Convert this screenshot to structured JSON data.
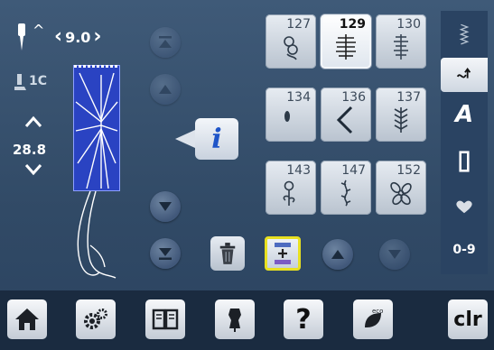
{
  "stitch_width": "9.0",
  "presser_foot": "1C",
  "stitch_length": "28.8",
  "stitches": [
    {
      "number": "127",
      "selected": false
    },
    {
      "number": "129",
      "selected": true
    },
    {
      "number": "130",
      "selected": false
    },
    {
      "number": "134",
      "selected": false
    },
    {
      "number": "136",
      "selected": false
    },
    {
      "number": "137",
      "selected": false
    },
    {
      "number": "143",
      "selected": false
    },
    {
      "number": "147",
      "selected": false
    },
    {
      "number": "152",
      "selected": false
    }
  ],
  "info_label": "i",
  "right_tabs": {
    "alphabet_label": "A",
    "numbers_label": "0-9"
  },
  "bottom_bar": {
    "help_label": "?",
    "eco_label": "eco",
    "clear_label": "clr"
  },
  "colors": {
    "background": "#3a5473",
    "preview": "#2a43c2",
    "highlight": "#e8e020",
    "bottom_bar": "#1a2b40"
  }
}
